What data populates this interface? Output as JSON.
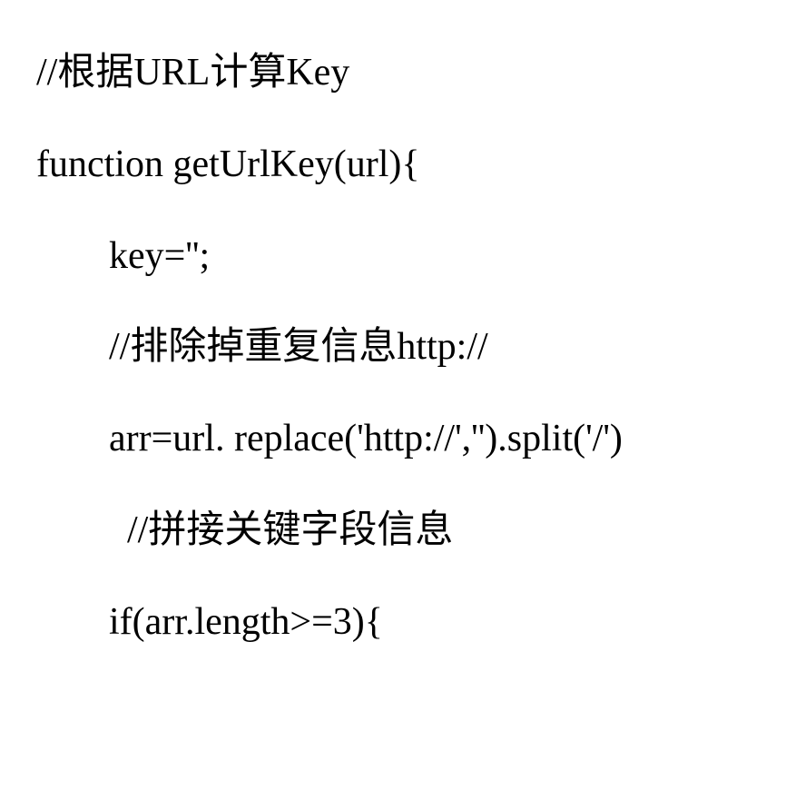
{
  "code": {
    "line1": "//根据URL计算Key",
    "line2": "function getUrlKey(url){",
    "line3": "key='';",
    "line4": "//排除掉重复信息http://",
    "line5": "arr=url. replace('http://','').split('/')",
    "line6": "//拼接关键字段信息",
    "line7": "if(arr.length>=3){"
  }
}
